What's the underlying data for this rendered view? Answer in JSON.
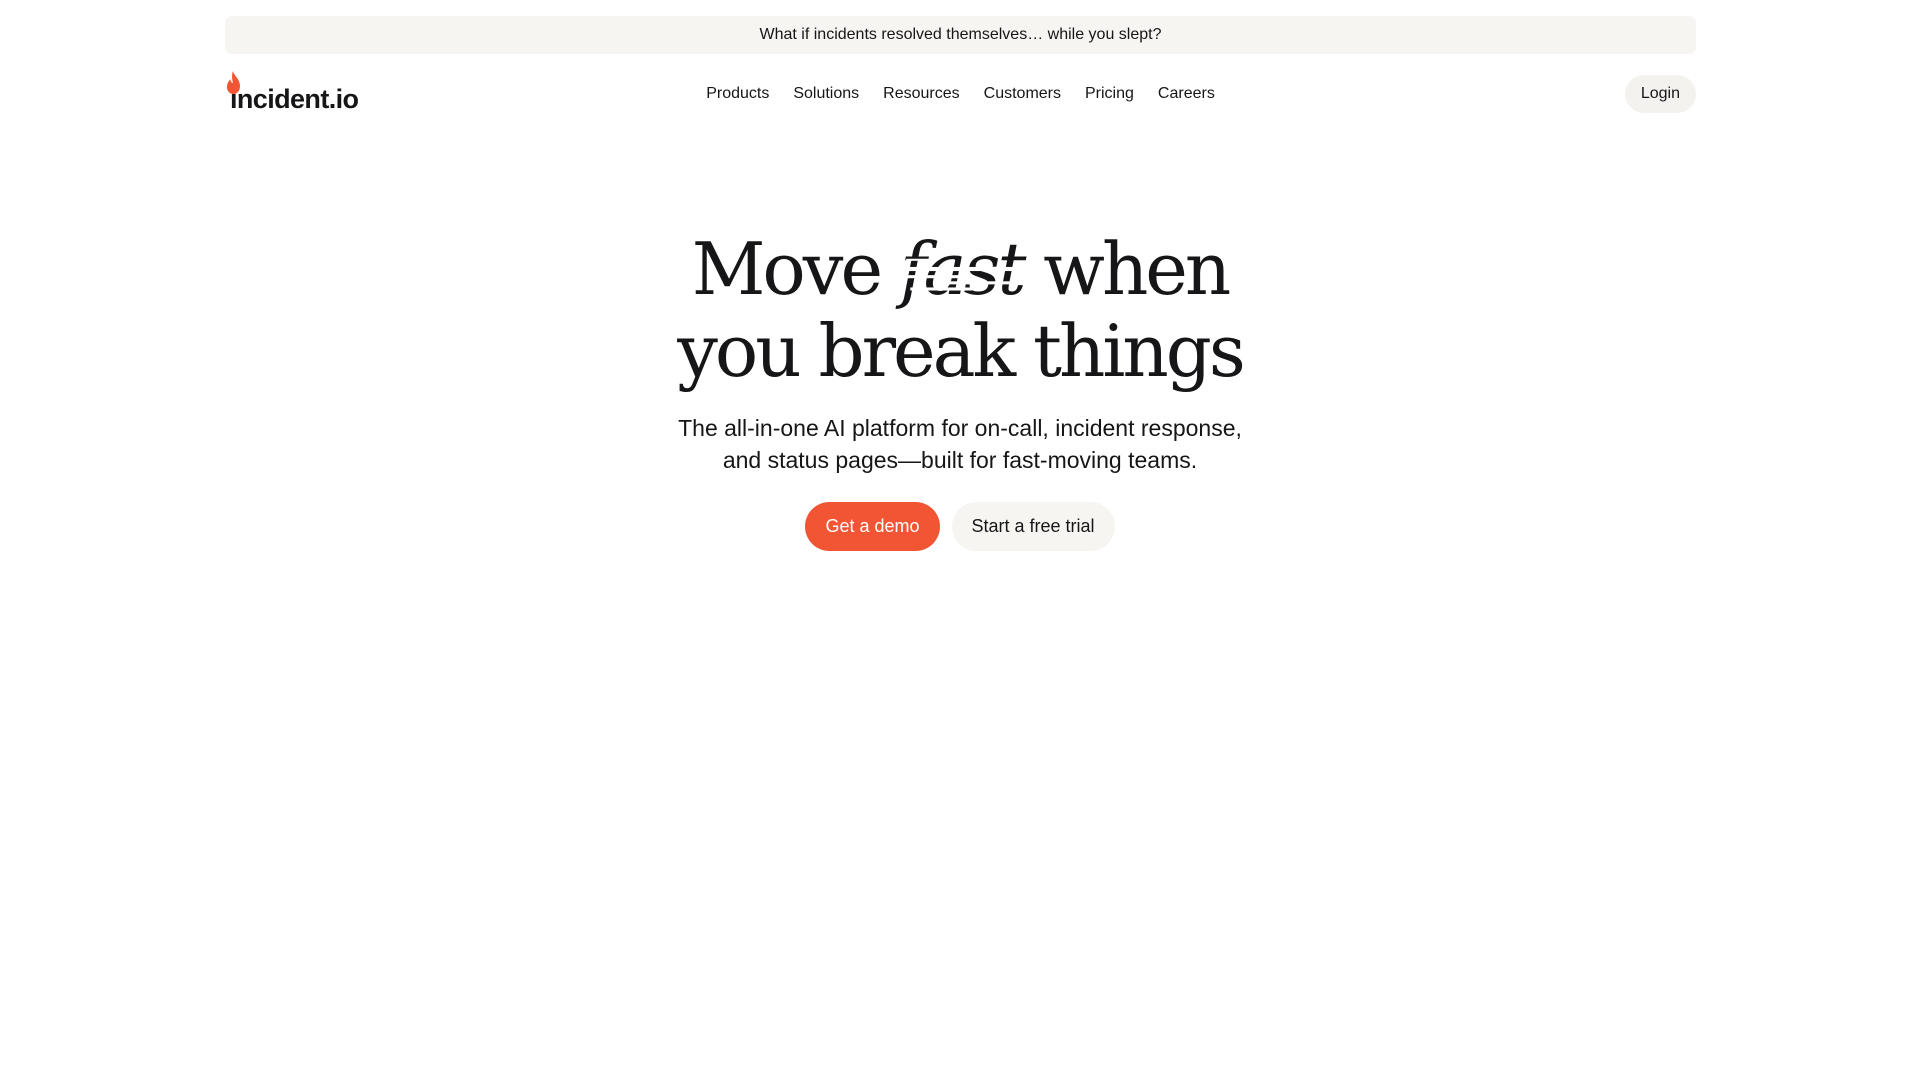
{
  "announcement": {
    "text": "What if incidents resolved themselves… while you slept?"
  },
  "header": {
    "logo_text": "incident.io",
    "nav_items": [
      {
        "label": "Products"
      },
      {
        "label": "Solutions"
      },
      {
        "label": "Resources"
      },
      {
        "label": "Customers"
      },
      {
        "label": "Pricing"
      },
      {
        "label": "Careers"
      }
    ],
    "login_label": "Login"
  },
  "hero": {
    "title_part1": "Move ",
    "title_emphasis": "fast",
    "title_part2": " when",
    "title_line2": "you break things",
    "subtitle_line1": "The all-in-one AI platform for on-call, incident response,",
    "subtitle_line2": "and status pages—built for fast-moving teams.",
    "primary_cta": "Get a demo",
    "secondary_cta": "Start a free trial"
  },
  "colors": {
    "brand_accent": "#f25533",
    "banner_bg": "#f7f5f2",
    "text": "#161618"
  },
  "icons": {
    "logo": "flame-icon"
  }
}
